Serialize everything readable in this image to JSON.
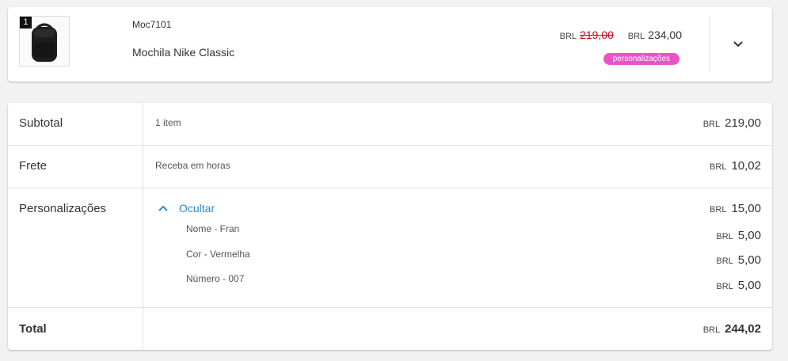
{
  "product": {
    "quantity": "1",
    "sku": "Moc7101",
    "name": "Mochila Nike Classic",
    "old_price": {
      "currency": "BRL",
      "value": "219,00"
    },
    "price": {
      "currency": "BRL",
      "value": "234,00"
    },
    "badge": "personalizações",
    "colors": {
      "badge": "#e754c6",
      "old_price": "#d0021b"
    },
    "expand_icon": "chevron-down-icon"
  },
  "summary": {
    "subtotal": {
      "label": "Subtotal",
      "desc": "1 item",
      "currency": "BRL",
      "value": "219,00"
    },
    "shipping": {
      "label": "Frete",
      "desc": "Receba em horas",
      "currency": "BRL",
      "value": "10,02"
    },
    "customizations": {
      "label": "Personalizações",
      "toggle_label": "Ocultar",
      "toggle_icon": "chevron-up-icon",
      "currency": "BRL",
      "value": "15,00",
      "items": [
        {
          "label": "Nome - Fran",
          "currency": "BRL",
          "value": "5,00"
        },
        {
          "label": "Cor - Vermelha",
          "currency": "BRL",
          "value": "5,00"
        },
        {
          "label": "Número - 007",
          "currency": "BRL",
          "value": "5,00"
        }
      ]
    },
    "total": {
      "label": "Total",
      "currency": "BRL",
      "value": "244,02"
    },
    "colors": {
      "accent": "#2a8cd3"
    }
  }
}
